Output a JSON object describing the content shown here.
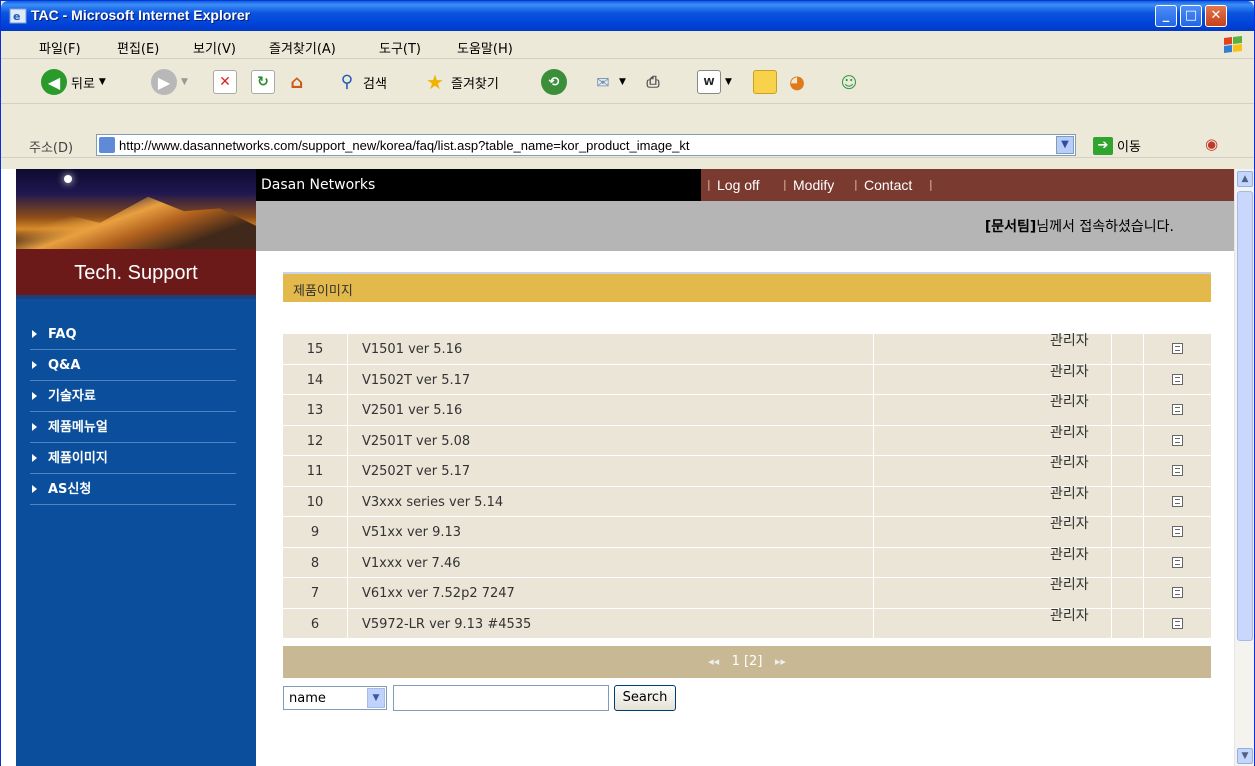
{
  "window": {
    "title": "TAC - Microsoft Internet Explorer"
  },
  "menu": [
    "파일(F)",
    "편집(E)",
    "보기(V)",
    "즐겨찾기(A)",
    "도구(T)",
    "도움말(H)"
  ],
  "toolbar": {
    "back_label": "뒤로",
    "search_label": "검색",
    "favorites_label": "즐겨찾기"
  },
  "address": {
    "label": "주소(D)",
    "url": "http://www.dasannetworks.com/support_new/korea/faq/list.asp?table_name=kor_product_image_kt",
    "go_label": "이동"
  },
  "site": {
    "sidebar_title": "Tech. Support",
    "nav": [
      "FAQ",
      "Q&A",
      "기술자료",
      "제품메뉴얼",
      "제품이미지",
      "AS신청"
    ],
    "company": "Dasan Networks",
    "links": [
      "Log off",
      "Modify",
      "Contact"
    ],
    "greeting_name": "[문서팀]",
    "greeting_text": "님께서 접속하셨습니다.",
    "section_title": "제품이미지"
  },
  "table": {
    "rows": [
      {
        "num": "15",
        "title": "V1501 ver 5.16",
        "author": "관리자"
      },
      {
        "num": "14",
        "title": "V1502T ver 5.17",
        "author": "관리자"
      },
      {
        "num": "13",
        "title": "V2501 ver 5.16",
        "author": "관리자"
      },
      {
        "num": "12",
        "title": "V2501T ver 5.08",
        "author": "관리자"
      },
      {
        "num": "11",
        "title": "V2502T ver 5.17",
        "author": "관리자"
      },
      {
        "num": "10",
        "title": "V3xxx series ver 5.14",
        "author": "관리자"
      },
      {
        "num": "9",
        "title": "V51xx ver 9.13",
        "author": "관리자"
      },
      {
        "num": "8",
        "title": "V1xxx ver 7.46",
        "author": "관리자"
      },
      {
        "num": "7",
        "title": "V61xx ver 7.52p2 7247",
        "author": "관리자"
      },
      {
        "num": "6",
        "title": "V5972-LR ver 9.13 #4535",
        "author": "관리자"
      }
    ]
  },
  "pagination": {
    "text": "1 [2]"
  },
  "search": {
    "field_selected": "name",
    "query": "",
    "button_label": "Search"
  },
  "colors": {
    "title_bar": "#0054e3",
    "sidebar_bg": "#0b4f9c",
    "sidebar_title_bg": "#6b1a19",
    "section_bar": "#e2b94a",
    "row_bg": "#ebe5d8",
    "pager_bg": "#c9b894"
  }
}
